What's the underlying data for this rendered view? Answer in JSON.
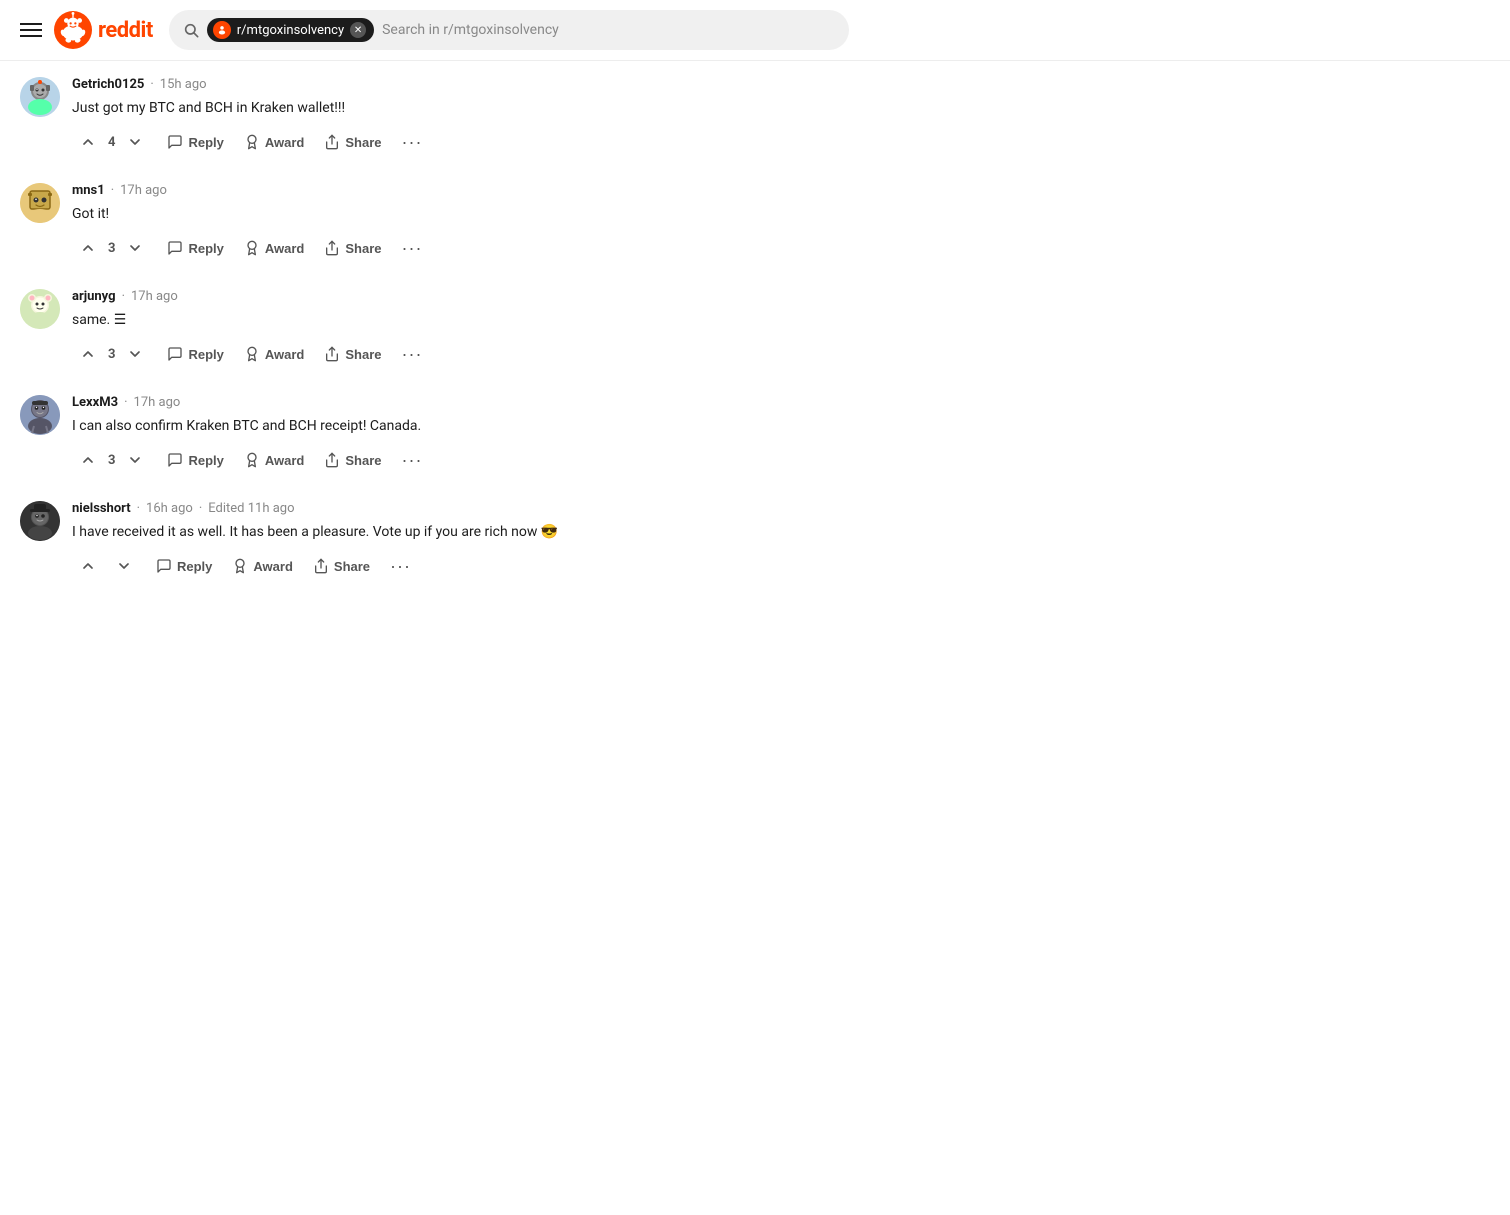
{
  "header": {
    "hamburger_label": "Menu",
    "logo_text": "reddit",
    "subreddit_name": "r/mtgoxinsolvency",
    "search_placeholder": "Search in r/mtgoxinsolvency"
  },
  "comments": [
    {
      "id": "c1",
      "username": "Getrich0125",
      "timestamp": "15h ago",
      "edited": null,
      "text": "Just got my BTC and BCH in Kraken wallet!!!",
      "votes": 4,
      "avatar_class": "av1"
    },
    {
      "id": "c2",
      "username": "mns1",
      "timestamp": "17h ago",
      "edited": null,
      "text": "Got it!",
      "votes": 3,
      "avatar_class": "av2"
    },
    {
      "id": "c3",
      "username": "arjunyg",
      "timestamp": "17h ago",
      "edited": null,
      "text": "same. ☰",
      "votes": 3,
      "avatar_class": "av3"
    },
    {
      "id": "c4",
      "username": "LexxM3",
      "timestamp": "17h ago",
      "edited": null,
      "text": "I can also confirm Kraken BTC and BCH receipt! Canada.",
      "votes": 3,
      "avatar_class": "av4"
    },
    {
      "id": "c5",
      "username": "nielsshort",
      "timestamp": "16h ago",
      "edited": "Edited 11h ago",
      "text": "I have received it as well. It has been a pleasure. Vote up if you are rich now 😎",
      "votes": null,
      "avatar_class": "av5"
    }
  ],
  "actions": {
    "reply": "Reply",
    "award": "Award",
    "share": "Share",
    "more": "···"
  },
  "colors": {
    "reddit_orange": "#ff4500",
    "upvote": "#ff4500",
    "text_muted": "#888888",
    "action_text": "#555555"
  }
}
